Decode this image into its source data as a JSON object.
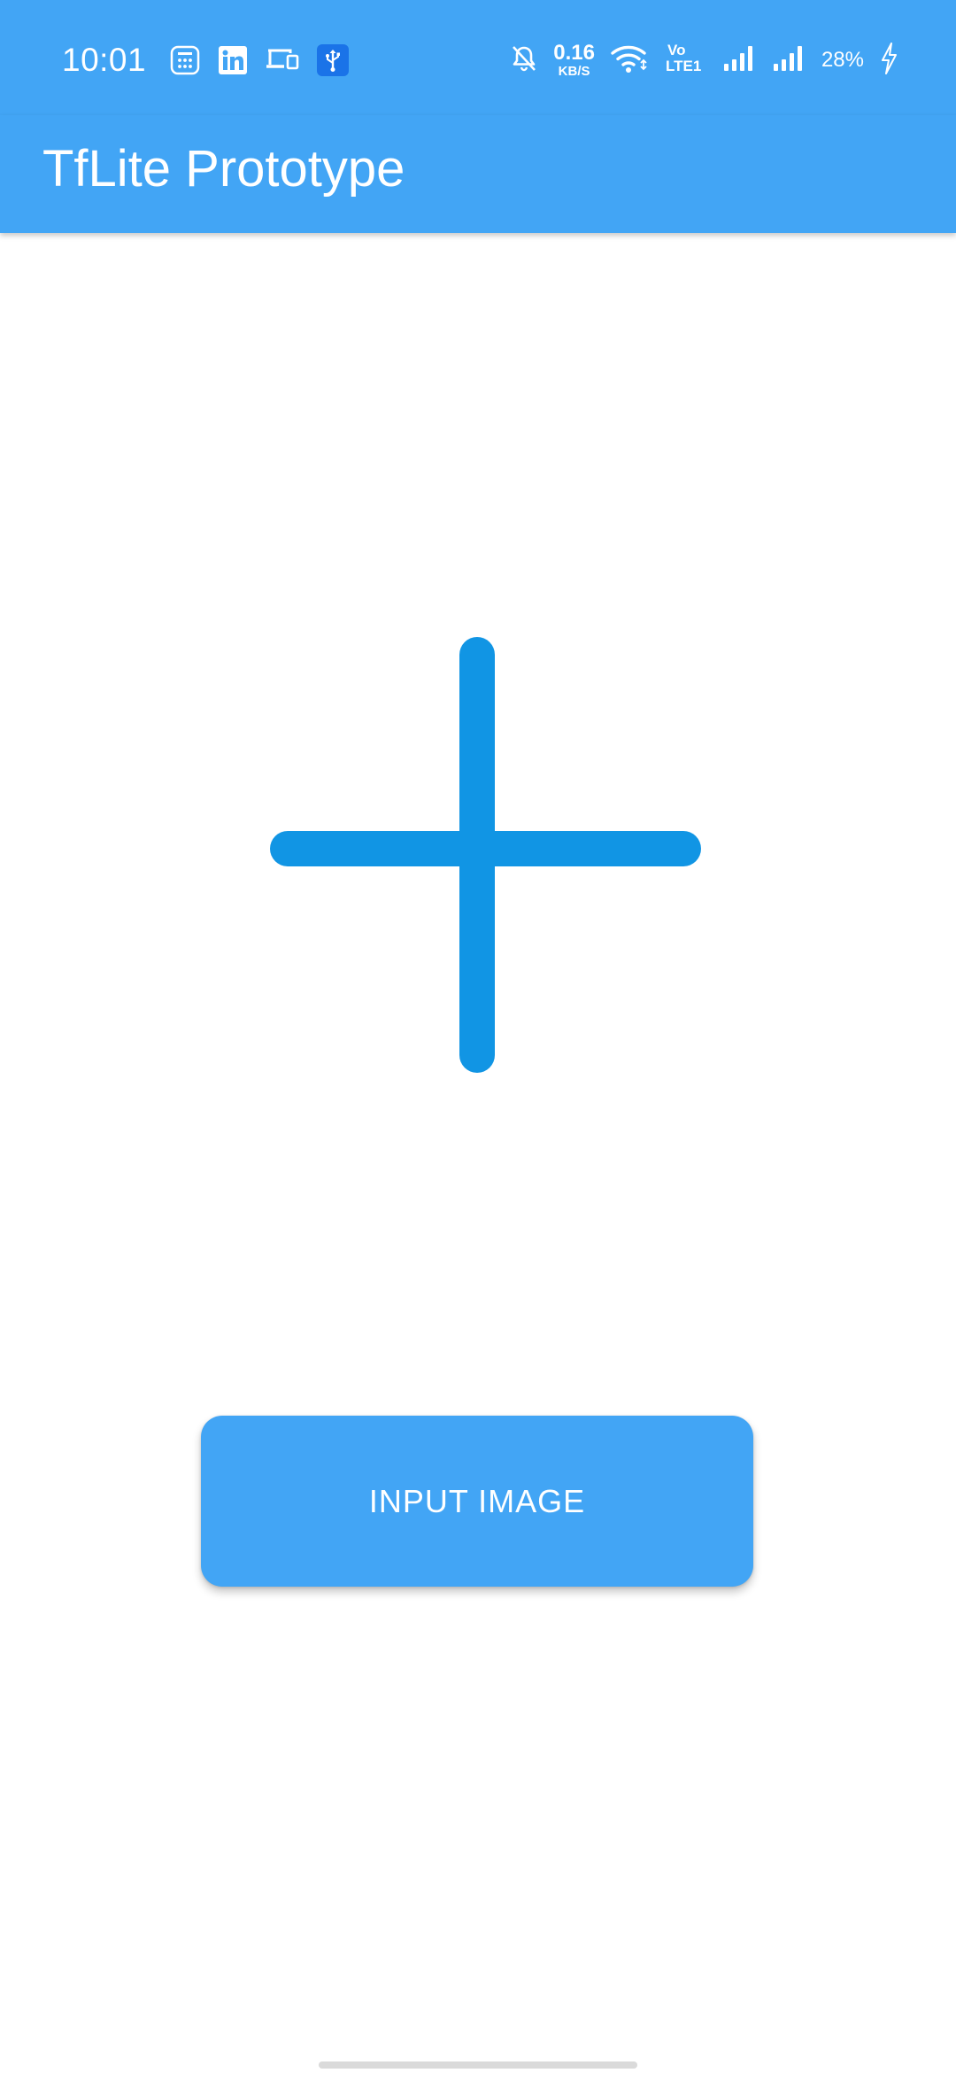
{
  "status_bar": {
    "time": "10:01",
    "left_icons": [
      "calculator-icon",
      "linkedin-icon",
      "devices-icon",
      "usb-icon"
    ],
    "net_speed_value": "0.16",
    "net_speed_unit": "KB/S",
    "volte_line1": "Vo",
    "volte_line2": "LTE1",
    "battery_percent": "28%",
    "right_icons": [
      "bell-off-icon",
      "wifi-icon",
      "volte-icon",
      "signal-icon",
      "signal-icon",
      "charging-bolt-icon"
    ]
  },
  "app_bar": {
    "title": "TfLite Prototype"
  },
  "main": {
    "image_placeholder_icon": "add-icon",
    "button_label": "INPUT IMAGE"
  },
  "colors": {
    "primary": "#42a5f5",
    "plus_icon": "#1195e4",
    "background": "#ffffff"
  }
}
